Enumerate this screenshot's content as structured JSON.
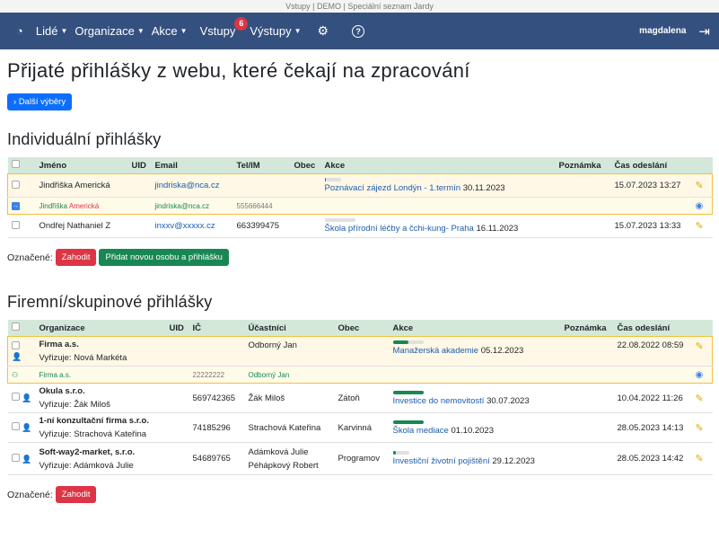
{
  "window_title": "Vstupy | DEMO | Speciální seznam Jardy",
  "nav": {
    "items": [
      "Lidé",
      "Organizace",
      "Akce",
      "Vstupy",
      "Výstupy"
    ],
    "vstupy_badge": "6",
    "user": "magdalena"
  },
  "page_title": "Přijaté přihlášky z webu, které čekají na zpracování",
  "more_button": "Další výběry",
  "individual": {
    "heading": "Individuální přihlášky",
    "columns": [
      "Jméno",
      "UID",
      "Email",
      "Tel/IM",
      "Obec",
      "Akce",
      "Poznámka",
      "Čas odeslání"
    ],
    "rows": [
      {
        "name": "Jindřiška Americká",
        "uid": "",
        "email": "jindriska@nca.cz",
        "tel": "",
        "obec": "",
        "akce": "Poznávací zájezd Londýn - 1.termín",
        "akce_date": "30.11.2023",
        "poznamka": "",
        "cas": "15.07.2023 13:27",
        "progress": 0.1
      },
      {
        "name": "Ondřej Nathaniel Z",
        "uid": "",
        "email": "inxxv@xxxxx.cz",
        "tel": "663399475",
        "obec": "",
        "akce": "Škola přírodní léčby a čchi-kung- Praha",
        "akce_date": "16.11.2023",
        "poznamka": "",
        "cas": "15.07.2023 13:33",
        "progress": 0
      }
    ],
    "match": {
      "first": "Jindřiška",
      "last": "Americká",
      "email": "jindriska@nca.cz",
      "tel": "555666444"
    },
    "marked_label": "Označené:",
    "discard_label": "Zahodit",
    "add_label": "Přidat novou osobu a přihlášku"
  },
  "company": {
    "heading": "Firemní/skupinové přihlášky",
    "columns": [
      "Organizace",
      "UID",
      "IČ",
      "Účastníci",
      "Obec",
      "Akce",
      "Poznámka",
      "Čas odeslání"
    ],
    "rows": [
      {
        "org": "Firma a.s.",
        "handler": "Vyřizuje: Nová Markéta",
        "uid": "",
        "ic": "",
        "participants": [
          "Odborný Jan"
        ],
        "obec": "",
        "akce": "Manažerská akademie",
        "akce_date": "05.12.2023",
        "cas": "22.08.2022 08:59",
        "progress": 0.5
      },
      {
        "org": "Okula s.r.o.",
        "handler": "Vyřizuje: Žák Miloš",
        "uid": "",
        "ic": "569742365",
        "participants": [
          "Žák Miloš"
        ],
        "obec": "Zátoň",
        "akce": "Investice do nemovitostí",
        "akce_date": "30.07.2023",
        "cas": "10.04.2022 11:26",
        "progress": 1
      },
      {
        "org": "1-ní konzultační firma s.r.o.",
        "handler": "Vyřizuje: Strachová Kateřina",
        "uid": "",
        "ic": "74185296",
        "participants": [
          "Strachová Kateřina"
        ],
        "obec": "Karvinná",
        "akce": "Škola mediace",
        "akce_date": "01.10.2023",
        "cas": "28.05.2023 14:13",
        "progress": 1
      },
      {
        "org": "Soft-way2-market, s.r.o.",
        "handler": "Vyřizuje: Adámková Julie",
        "uid": "",
        "ic": "54689765",
        "participants": [
          "Adámková Julie",
          "Péhápkový Robert"
        ],
        "obec": "Programov",
        "akce": "Investiční životní pojištění",
        "akce_date": "29.12.2023",
        "cas": "28.05.2023 14:42",
        "progress": 0.2
      }
    ],
    "match": {
      "org": "Firma a.s.",
      "ic": "22222222",
      "participant": "Odborný Jan"
    },
    "marked_label": "Označené:",
    "discard_label": "Zahodit"
  },
  "colors": {
    "navbar": "#34507f",
    "primary": "#0d6efd",
    "danger": "#dc3545",
    "success": "#198754",
    "highlight": "#f0c040"
  }
}
